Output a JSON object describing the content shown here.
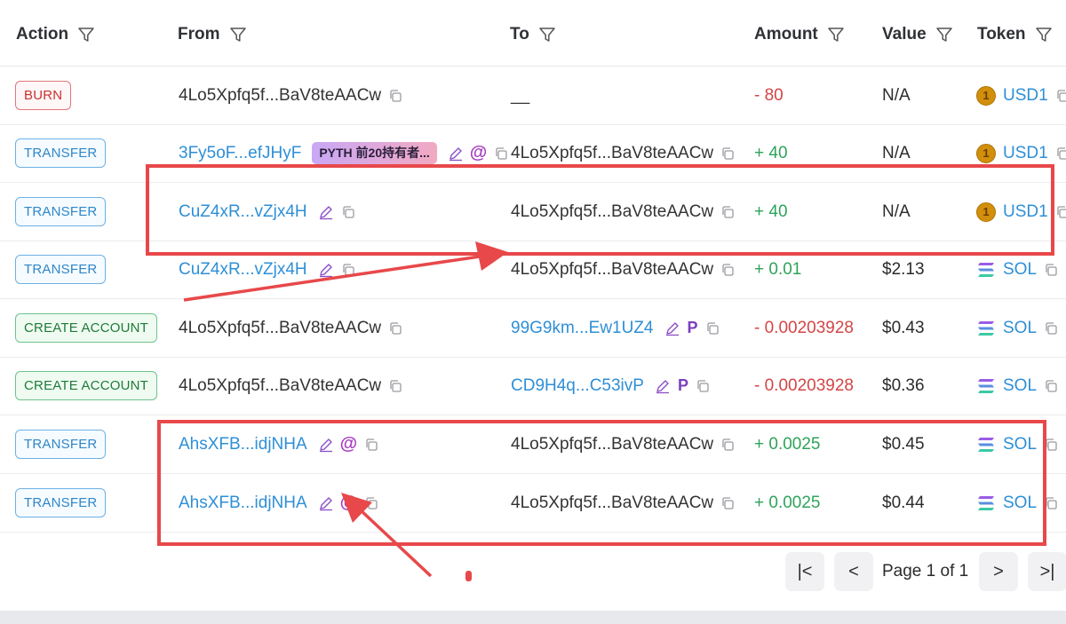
{
  "headers": {
    "action": "Action",
    "from": "From",
    "to": "To",
    "amount": "Amount",
    "value": "Value",
    "token": "Token"
  },
  "rows": [
    {
      "action": "BURN",
      "from": "4Lo5Xpfq5f...BaV8teAACw",
      "to": "__",
      "amount": "- 80",
      "value": "N/A",
      "token": "USD1"
    },
    {
      "action": "TRANSFER",
      "from": "3Fy5oF...efJHyF",
      "from_tag": "PYTH 前20持有者...",
      "to": "4Lo5Xpfq5f...BaV8teAACw",
      "amount": "+ 40",
      "value": "N/A",
      "token": "USD1"
    },
    {
      "action": "TRANSFER",
      "from": "CuZ4xR...vZjx4H",
      "to": "4Lo5Xpfq5f...BaV8teAACw",
      "amount": "+ 40",
      "value": "N/A",
      "token": "USD1"
    },
    {
      "action": "TRANSFER",
      "from": "CuZ4xR...vZjx4H",
      "to": "4Lo5Xpfq5f...BaV8teAACw",
      "amount": "+ 0.01",
      "value": "$2.13",
      "token": "SOL"
    },
    {
      "action": "CREATE ACCOUNT",
      "from": "4Lo5Xpfq5f...BaV8teAACw",
      "to": "99G9km...Ew1UZ4",
      "amount": "- 0.00203928",
      "value": "$0.43",
      "token": "SOL"
    },
    {
      "action": "CREATE ACCOUNT",
      "from": "4Lo5Xpfq5f...BaV8teAACw",
      "to": "CD9H4q...C53ivP",
      "amount": "- 0.00203928",
      "value": "$0.36",
      "token": "SOL"
    },
    {
      "action": "TRANSFER",
      "from": "AhsXFB...idjNHA",
      "to": "4Lo5Xpfq5f...BaV8teAACw",
      "amount": "+ 0.0025",
      "value": "$0.45",
      "token": "SOL"
    },
    {
      "action": "TRANSFER",
      "from": "AhsXFB...idjNHA",
      "to": "4Lo5Xpfq5f...BaV8teAACw",
      "amount": "+ 0.0025",
      "value": "$0.44",
      "token": "SOL"
    }
  ],
  "labels": {
    "at_symbol": "@",
    "p_symbol": "P",
    "usd1_coin_symbol": "1"
  },
  "pagination": {
    "page_label": "Page 1 of 1",
    "first": "|<",
    "prev": "<",
    "next": ">",
    "last": ">|"
  },
  "colors": {
    "annotation_red": "#e8484a",
    "link_blue": "#2e8fd6",
    "negative": "#d44545",
    "positive": "#2ea35a"
  }
}
